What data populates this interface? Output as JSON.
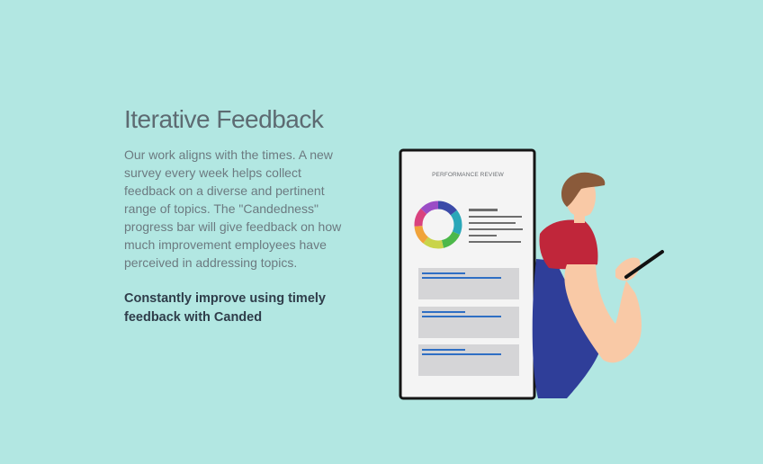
{
  "section": {
    "title": "Iterative Feedback",
    "body": "Our work aligns with the times. A new survey every week helps collect feedback on a diverse and pertinent range of topics. The \"Candedness\" progress bar will give feedback on how much improvement employees have perceived in addressing topics.",
    "tagline": "Constantly improve using timely feedback with Canded"
  },
  "illustration": {
    "screen_title": "PERFORMANCE REVIEW",
    "donut_colors": [
      "#3b4aa8",
      "#2aa7b8",
      "#4cb84a",
      "#c9d44a",
      "#f0a33a",
      "#d9427e",
      "#9b4dc6"
    ]
  },
  "colors": {
    "background": "#b2e7e2",
    "title": "#5d6b72",
    "body": "#6c7a80",
    "tagline": "#2f3d4a"
  }
}
